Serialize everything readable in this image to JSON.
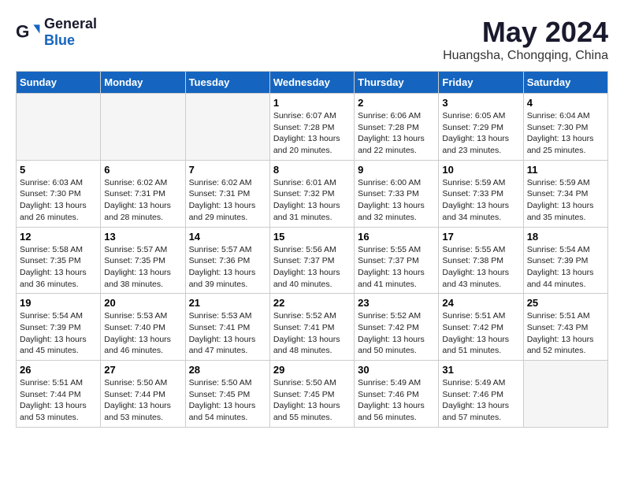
{
  "header": {
    "logo": {
      "general": "General",
      "blue": "Blue"
    },
    "title": "May 2024",
    "location": "Huangsha, Chongqing, China"
  },
  "weekdays": [
    "Sunday",
    "Monday",
    "Tuesday",
    "Wednesday",
    "Thursday",
    "Friday",
    "Saturday"
  ],
  "weeks": [
    [
      {
        "day": "",
        "content": ""
      },
      {
        "day": "",
        "content": ""
      },
      {
        "day": "",
        "content": ""
      },
      {
        "day": "1",
        "content": "Sunrise: 6:07 AM\nSunset: 7:28 PM\nDaylight: 13 hours\nand 20 minutes."
      },
      {
        "day": "2",
        "content": "Sunrise: 6:06 AM\nSunset: 7:28 PM\nDaylight: 13 hours\nand 22 minutes."
      },
      {
        "day": "3",
        "content": "Sunrise: 6:05 AM\nSunset: 7:29 PM\nDaylight: 13 hours\nand 23 minutes."
      },
      {
        "day": "4",
        "content": "Sunrise: 6:04 AM\nSunset: 7:30 PM\nDaylight: 13 hours\nand 25 minutes."
      }
    ],
    [
      {
        "day": "5",
        "content": "Sunrise: 6:03 AM\nSunset: 7:30 PM\nDaylight: 13 hours\nand 26 minutes."
      },
      {
        "day": "6",
        "content": "Sunrise: 6:02 AM\nSunset: 7:31 PM\nDaylight: 13 hours\nand 28 minutes."
      },
      {
        "day": "7",
        "content": "Sunrise: 6:02 AM\nSunset: 7:31 PM\nDaylight: 13 hours\nand 29 minutes."
      },
      {
        "day": "8",
        "content": "Sunrise: 6:01 AM\nSunset: 7:32 PM\nDaylight: 13 hours\nand 31 minutes."
      },
      {
        "day": "9",
        "content": "Sunrise: 6:00 AM\nSunset: 7:33 PM\nDaylight: 13 hours\nand 32 minutes."
      },
      {
        "day": "10",
        "content": "Sunrise: 5:59 AM\nSunset: 7:33 PM\nDaylight: 13 hours\nand 34 minutes."
      },
      {
        "day": "11",
        "content": "Sunrise: 5:59 AM\nSunset: 7:34 PM\nDaylight: 13 hours\nand 35 minutes."
      }
    ],
    [
      {
        "day": "12",
        "content": "Sunrise: 5:58 AM\nSunset: 7:35 PM\nDaylight: 13 hours\nand 36 minutes."
      },
      {
        "day": "13",
        "content": "Sunrise: 5:57 AM\nSunset: 7:35 PM\nDaylight: 13 hours\nand 38 minutes."
      },
      {
        "day": "14",
        "content": "Sunrise: 5:57 AM\nSunset: 7:36 PM\nDaylight: 13 hours\nand 39 minutes."
      },
      {
        "day": "15",
        "content": "Sunrise: 5:56 AM\nSunset: 7:37 PM\nDaylight: 13 hours\nand 40 minutes."
      },
      {
        "day": "16",
        "content": "Sunrise: 5:55 AM\nSunset: 7:37 PM\nDaylight: 13 hours\nand 41 minutes."
      },
      {
        "day": "17",
        "content": "Sunrise: 5:55 AM\nSunset: 7:38 PM\nDaylight: 13 hours\nand 43 minutes."
      },
      {
        "day": "18",
        "content": "Sunrise: 5:54 AM\nSunset: 7:39 PM\nDaylight: 13 hours\nand 44 minutes."
      }
    ],
    [
      {
        "day": "19",
        "content": "Sunrise: 5:54 AM\nSunset: 7:39 PM\nDaylight: 13 hours\nand 45 minutes."
      },
      {
        "day": "20",
        "content": "Sunrise: 5:53 AM\nSunset: 7:40 PM\nDaylight: 13 hours\nand 46 minutes."
      },
      {
        "day": "21",
        "content": "Sunrise: 5:53 AM\nSunset: 7:41 PM\nDaylight: 13 hours\nand 47 minutes."
      },
      {
        "day": "22",
        "content": "Sunrise: 5:52 AM\nSunset: 7:41 PM\nDaylight: 13 hours\nand 48 minutes."
      },
      {
        "day": "23",
        "content": "Sunrise: 5:52 AM\nSunset: 7:42 PM\nDaylight: 13 hours\nand 50 minutes."
      },
      {
        "day": "24",
        "content": "Sunrise: 5:51 AM\nSunset: 7:42 PM\nDaylight: 13 hours\nand 51 minutes."
      },
      {
        "day": "25",
        "content": "Sunrise: 5:51 AM\nSunset: 7:43 PM\nDaylight: 13 hours\nand 52 minutes."
      }
    ],
    [
      {
        "day": "26",
        "content": "Sunrise: 5:51 AM\nSunset: 7:44 PM\nDaylight: 13 hours\nand 53 minutes."
      },
      {
        "day": "27",
        "content": "Sunrise: 5:50 AM\nSunset: 7:44 PM\nDaylight: 13 hours\nand 53 minutes."
      },
      {
        "day": "28",
        "content": "Sunrise: 5:50 AM\nSunset: 7:45 PM\nDaylight: 13 hours\nand 54 minutes."
      },
      {
        "day": "29",
        "content": "Sunrise: 5:50 AM\nSunset: 7:45 PM\nDaylight: 13 hours\nand 55 minutes."
      },
      {
        "day": "30",
        "content": "Sunrise: 5:49 AM\nSunset: 7:46 PM\nDaylight: 13 hours\nand 56 minutes."
      },
      {
        "day": "31",
        "content": "Sunrise: 5:49 AM\nSunset: 7:46 PM\nDaylight: 13 hours\nand 57 minutes."
      },
      {
        "day": "",
        "content": ""
      }
    ]
  ]
}
